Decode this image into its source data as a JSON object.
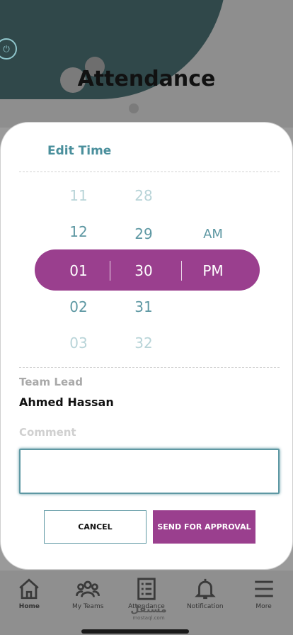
{
  "page": {
    "title": "Attendance"
  },
  "modal": {
    "title": "Edit Time",
    "picker": {
      "hours": [
        "11",
        "12",
        "01",
        "02",
        "03"
      ],
      "minutes": [
        "28",
        "29",
        "30",
        "31",
        "32"
      ],
      "periods": [
        "AM",
        "PM"
      ],
      "selected": {
        "hour": "01",
        "minute": "30",
        "period": "PM"
      }
    },
    "team_lead_label": "Team Lead",
    "team_lead_name": "Ahmed Hassan",
    "comment_label": "Comment",
    "comment_value": "",
    "cancel_label": "CANCEL",
    "send_label": "SEND FOR APPROVAL"
  },
  "nav": {
    "items": [
      {
        "label": "Home",
        "icon": "home-icon"
      },
      {
        "label": "My Teams",
        "icon": "team-icon"
      },
      {
        "label": "Attendance",
        "icon": "checklist-icon"
      },
      {
        "label": "Notification",
        "icon": "bell-icon"
      },
      {
        "label": "More",
        "icon": "menu-icon"
      }
    ]
  },
  "watermark": {
    "text": "مستقل",
    "sub": "mostaql.com"
  },
  "colors": {
    "accent": "#9a3f8e",
    "teal": "#5e98a3",
    "dark_blob": "#2b4547"
  }
}
